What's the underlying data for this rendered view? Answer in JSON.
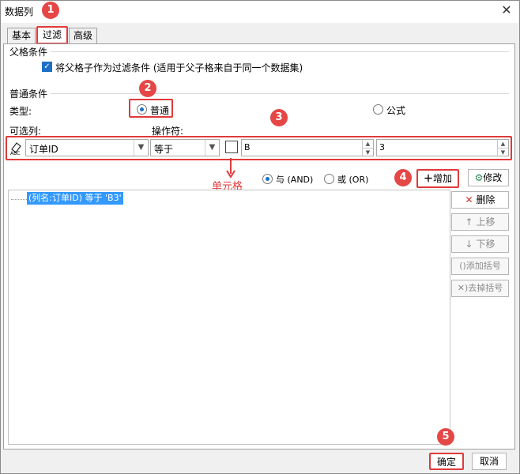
{
  "window": {
    "title": "数据列",
    "close_glyph": "✕"
  },
  "tabs": [
    {
      "label": "基本",
      "active": false
    },
    {
      "label": "过滤",
      "active": true
    },
    {
      "label": "高级",
      "active": false
    }
  ],
  "parent_group": {
    "title": "父格条件",
    "checkbox_label": "将父格子作为过滤条件 (适用于父子格来自于同一个数据集)",
    "checked": true
  },
  "normal_group": {
    "title": "普通条件",
    "type_label": "类型:",
    "type_options": [
      {
        "label": "普通",
        "selected": true
      },
      {
        "label": "公式",
        "selected": false
      }
    ],
    "column_label": "可选列:",
    "operator_label": "操作符:",
    "column_value": "订单ID",
    "operator_value": "等于",
    "value_mode_text": "B",
    "value_text": "3",
    "cell_annotation": "单元格",
    "logic_options": [
      {
        "label": "与 (AND)",
        "selected": true
      },
      {
        "label": "或 (OR)",
        "selected": false
      }
    ]
  },
  "buttons": {
    "add": "增加",
    "modify": "修改",
    "delete": "删除",
    "move_up": "上移",
    "move_down": "下移",
    "add_brackets": "添加括号",
    "remove_brackets": "去掉括号",
    "ok": "确定",
    "cancel": "取消"
  },
  "condition_list": [
    "(列名:订单ID) 等于 'B3'"
  ],
  "step_badges": [
    "1",
    "2",
    "3",
    "4",
    "5"
  ],
  "colors": {
    "highlight": "#e03a3a",
    "selection": "#3399ff",
    "accent": "#1c6fc4"
  }
}
